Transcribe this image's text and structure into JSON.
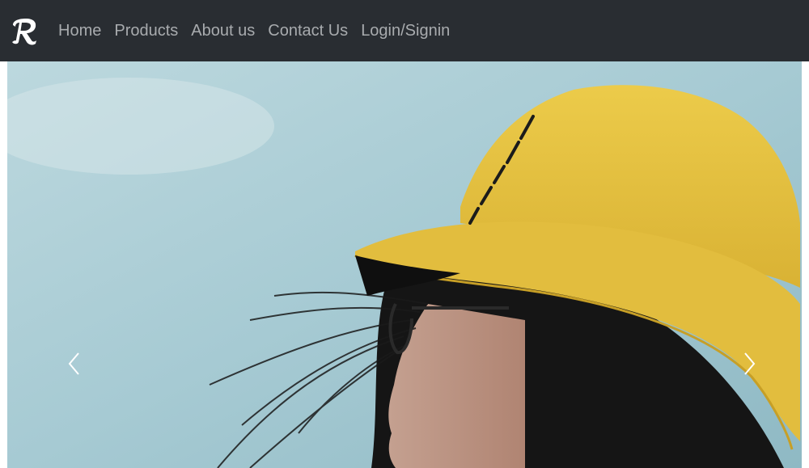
{
  "navbar": {
    "brand": "brand-logo-icon",
    "links": [
      "Home",
      "Products",
      "About us",
      "Contact Us",
      "Login/Signin"
    ]
  },
  "carousel": {
    "prev_icon": "chevron-left-icon",
    "next_icon": "chevron-right-icon",
    "slide": "woman-yellow-bucket-hat-photo"
  },
  "colors": {
    "navbar_bg": "#292d32",
    "nav_link": "#a8abae",
    "hat": "#e6c13f",
    "sky": "#a9cdd6"
  }
}
